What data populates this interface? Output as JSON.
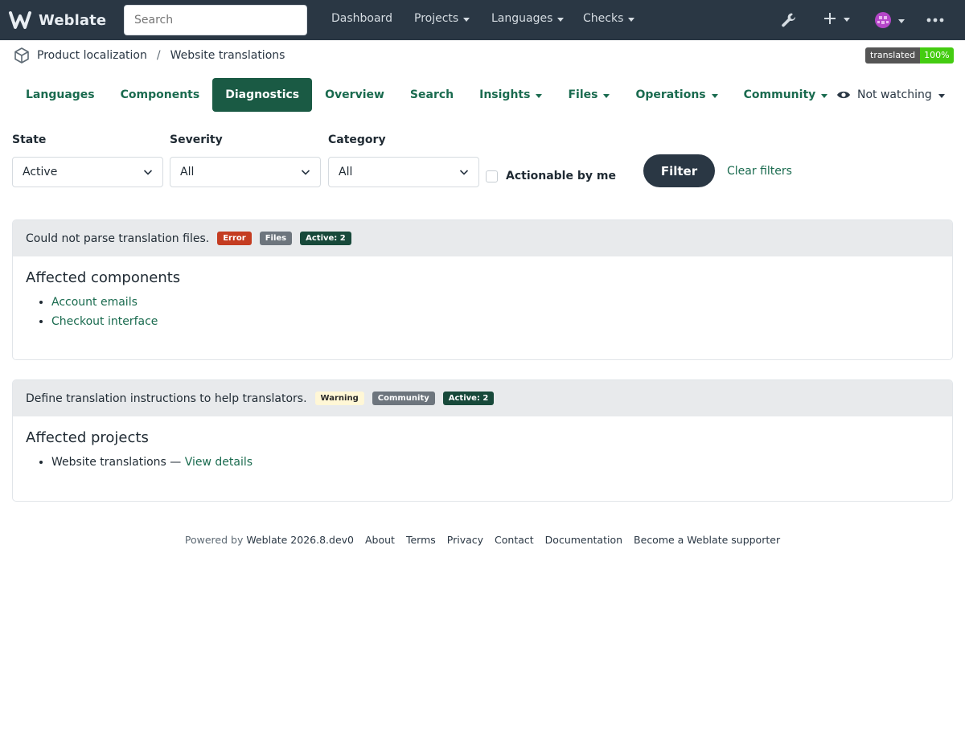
{
  "nav": {
    "brand": "Weblate",
    "search_placeholder": "Search",
    "links": [
      "Dashboard",
      "Projects",
      "Languages",
      "Checks"
    ]
  },
  "breadcrumb": {
    "project": "Product localization",
    "separator": "/",
    "component": "Website translations"
  },
  "badge": {
    "label": "translated",
    "value": "100%"
  },
  "tabs": [
    "Languages",
    "Components",
    "Diagnostics",
    "Overview",
    "Search",
    "Insights",
    "Files",
    "Operations",
    "Community"
  ],
  "active_tab": "Diagnostics",
  "watch": {
    "label": "Not watching"
  },
  "filters": {
    "state": {
      "label": "State",
      "value": "Active"
    },
    "severity": {
      "label": "Severity",
      "value": "All"
    },
    "category": {
      "label": "Category",
      "value": "All"
    },
    "actionable_label": "Actionable by me",
    "filter_button": "Filter",
    "clear_link": "Clear filters"
  },
  "alerts": [
    {
      "title": "Could not parse translation files.",
      "severity": "Error",
      "category": "Files",
      "active": "Active: 2",
      "section": "Affected components",
      "items": [
        {
          "link": "Account emails"
        },
        {
          "link": "Checkout interface"
        }
      ]
    },
    {
      "title": "Define translation instructions to help translators.",
      "severity": "Warning",
      "category": "Community",
      "active": "Active: 2",
      "section": "Affected projects",
      "items": [
        {
          "text": "Website translations —",
          "link": "View details"
        }
      ]
    }
  ],
  "footer": {
    "powered_by": "Powered by",
    "version": "Weblate 2026.8.dev0",
    "links": [
      "About",
      "Terms",
      "Privacy",
      "Contact",
      "Documentation",
      "Become a Weblate supporter"
    ]
  },
  "colors": {
    "navbar": "#2a3744",
    "accent": "#1a6b4f",
    "active_tab": "#1a5a44",
    "error": "#c43c21",
    "warning_bg": "#fff7d6",
    "active_pill": "#17493a"
  }
}
